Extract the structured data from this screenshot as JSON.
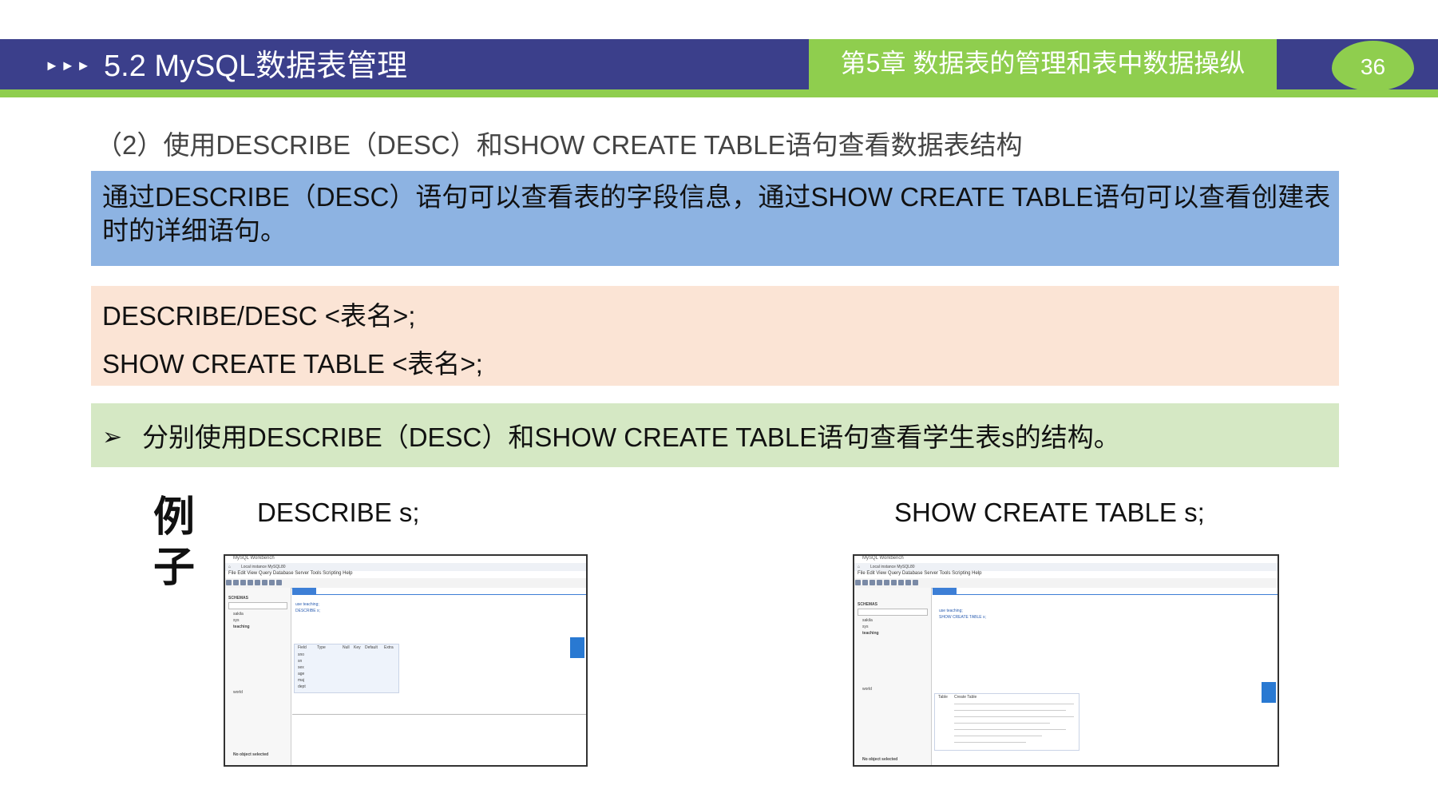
{
  "header": {
    "arrows": "►►►",
    "section_title": "5.2  MySQL数据表管理",
    "chapter_title": "第5章 数据表的管理和表中数据操纵",
    "page_number": "36"
  },
  "subtitle": "（2）使用DESCRIBE（DESC）和SHOW CREATE TABLE语句查看数据表结构",
  "intro": {
    "text": "通过DESCRIBE（DESC）语句可以查看表的字段信息，通过SHOW CREATE TABLE语句可以查看创建表时的详细语句。"
  },
  "syntax": {
    "line1": "DESCRIBE/DESC <表名>;",
    "line2": "SHOW CREATE TABLE <表名>;"
  },
  "task": {
    "bullet": "➢",
    "text": "分别使用DESCRIBE（DESC）和SHOW CREATE TABLE语句查看学生表s的结构。"
  },
  "example": {
    "label_char1": "例",
    "label_char2": "子",
    "cmd_left": "DESCRIBE s;",
    "cmd_right": "SHOW CREATE TABLE s;"
  },
  "screenshots": {
    "left": {
      "window_title": "MySQL Workbench",
      "connection_tab": "Local instance MySQL80",
      "menu": "File  Edit  View  Query  Database  Server  Tools  Scripting  Help",
      "nav_label": "SCHEMAS",
      "schemas": [
        "sakila",
        "sys",
        "teaching",
        "world"
      ],
      "sql_lines": [
        "use teaching;",
        "DESCRIBE s;"
      ],
      "result_columns": [
        "Field",
        "Type",
        "Null",
        "Key",
        "Default",
        "Extra"
      ],
      "result_fields": [
        "sno",
        "sn",
        "sex",
        "age",
        "maj",
        "dept"
      ],
      "info_text": "No object selected"
    },
    "right": {
      "window_title": "MySQL Workbench",
      "connection_tab": "Local instance MySQL80",
      "menu": "File  Edit  View  Query  Database  Server  Tools  Scripting  Help",
      "nav_label": "SCHEMAS",
      "schemas": [
        "sakila",
        "sys",
        "teaching",
        "world"
      ],
      "sql_lines": [
        "use teaching;",
        "SHOW CREATE TABLE s;"
      ],
      "result_columns": [
        "Table",
        "Create Table"
      ],
      "info_text": "No object selected"
    }
  },
  "colors": {
    "header_bar": "#3b3f8b",
    "accent_green": "#8fce4e",
    "intro_box": "#8db3e2",
    "syntax_box": "#fbe4d5",
    "task_box": "#d5e8c4"
  }
}
